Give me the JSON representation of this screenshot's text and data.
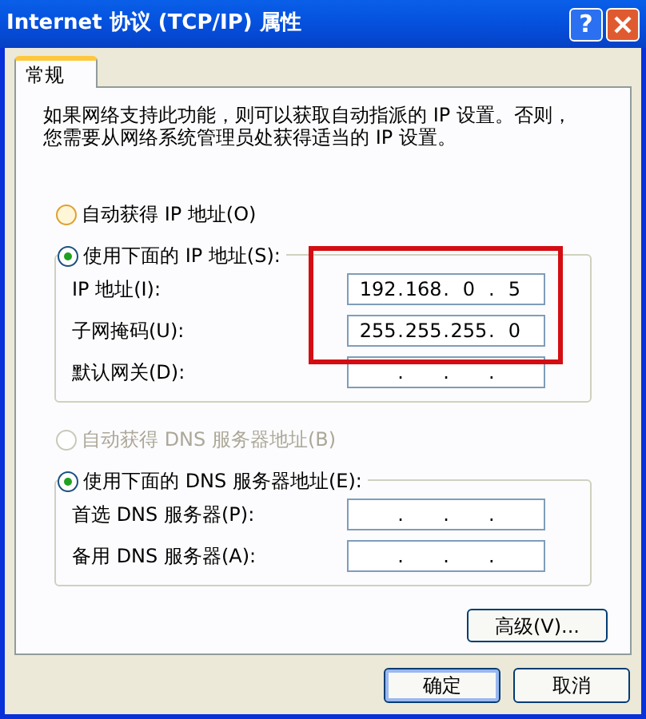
{
  "window": {
    "title": "Internet 协议 (TCP/IP) 属性",
    "buttons": [
      {
        "kind": "help",
        "label": "?"
      },
      {
        "kind": "close"
      }
    ]
  },
  "tabs": [
    {
      "label": "常规",
      "selected": true
    }
  ],
  "intro": [
    "如果网络支持此功能，则可以获取自动指派的 IP 设置。否则，",
    "您需要从网络系统管理员处获得适当的 IP 设置。"
  ],
  "ip_section": {
    "auto_option": {
      "label": "自动获得 IP 地址(O)",
      "selected": false,
      "disabled": false
    },
    "manual_option": {
      "label": "使用下面的 IP 地址(S):",
      "selected": true,
      "disabled": false
    },
    "fields": [
      {
        "label": "IP 地址(I):",
        "octets": [
          "192",
          "168",
          "0",
          "5"
        ],
        "dots": [
          ".",
          ".",
          "."
        ]
      },
      {
        "label": "子网掩码(U):",
        "octets": [
          "255",
          "255",
          "255",
          "0"
        ],
        "dots": [
          ".",
          ".",
          "."
        ]
      },
      {
        "label": "默认网关(D):",
        "dots": [
          ".",
          ".",
          "."
        ]
      }
    ]
  },
  "dns_section": {
    "auto_option": {
      "label": "自动获得 DNS 服务器地址(B)",
      "selected": false,
      "disabled": true
    },
    "manual_option": {
      "label": "使用下面的 DNS 服务器地址(E):",
      "selected": true,
      "disabled": false
    },
    "fields": [
      {
        "label": "首选 DNS 服务器(P):",
        "dots": [
          ".",
          ".",
          "."
        ]
      },
      {
        "label": "备用 DNS 服务器(A):",
        "dots": [
          ".",
          ".",
          "."
        ]
      }
    ]
  },
  "advanced_button": "高级(V)...",
  "annotation": {
    "kind": "frame"
  },
  "buttons": [
    "确定",
    "取消"
  ]
}
